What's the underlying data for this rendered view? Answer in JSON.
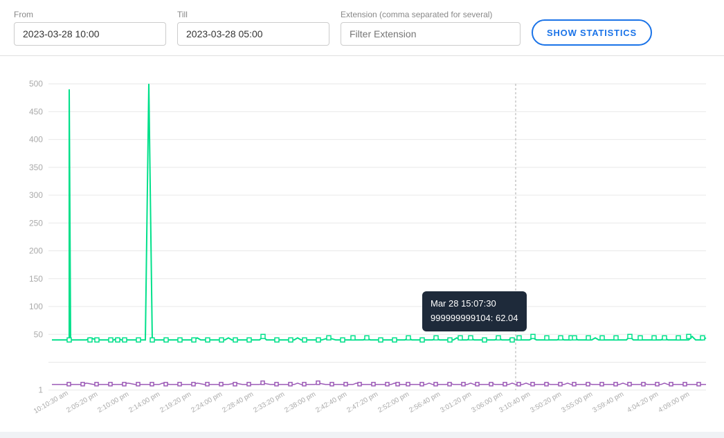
{
  "header": {
    "from_label": "From",
    "from_value": "2023-03-28 10:00",
    "till_label": "Till",
    "till_value": "2023-03-28 05:00",
    "extension_label": "Extension (comma separated for several)",
    "extension_placeholder": "Filter Extension",
    "show_stats_label": "SHOW STATISTICS"
  },
  "chart": {
    "y_labels": [
      "500",
      "450",
      "400",
      "350",
      "300",
      "250",
      "200",
      "150",
      "100",
      "50",
      "1"
    ],
    "x_labels": [
      "10:10:30 am",
      "2:05:20 pm",
      "2:10:00 pm",
      "2:14:00 pm",
      "2:19:20 pm",
      "2:24:00 pm",
      "2:28:40 pm",
      "2:33:20 pm",
      "2:38:00 pm",
      "2:42:40 pm",
      "2:47:20 pm",
      "2:52:00 pm",
      "2:56:40 pm",
      "3:01:20 pm",
      "3:06:00 pm",
      "3:10:40 pm",
      "3:50:20 pm",
      "3:55:00 pm",
      "3:59:40 pm",
      "4:04:20 pm",
      "4:09:00 pm"
    ],
    "tooltip": {
      "time": "Mar 28 15:07:30",
      "value": "999999999104: 62.04"
    },
    "colors": {
      "green": "#00e08a",
      "purple": "#9b59b6",
      "y_label": "#aaa",
      "x_label": "#aaa",
      "grid": "#e8e8e8"
    }
  }
}
